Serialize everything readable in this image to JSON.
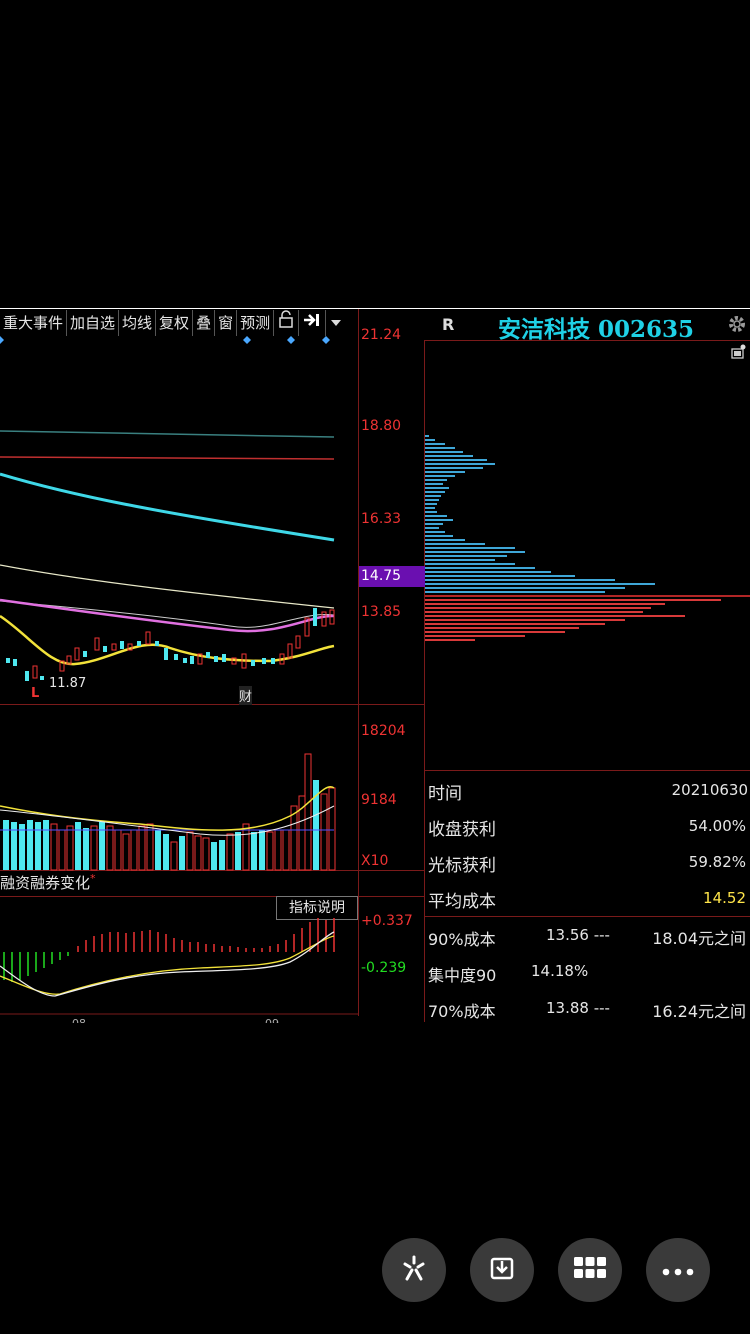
{
  "toolbar": {
    "items": [
      "重大事件",
      "加自选",
      "均线",
      "复权",
      "叠",
      "窗",
      "预测"
    ],
    "lock_icon": "lock-open-icon",
    "exit_icon": "arrow-right-bar-icon",
    "dropdown_icon": "triangle-down-icon"
  },
  "header": {
    "r_label": "R",
    "stock_title": "安洁科技 002635",
    "settings_icon": "gear-icon",
    "small_icon": "lock-small-icon"
  },
  "price_axis": {
    "labels": [
      "21.24",
      "18.80",
      "16.33",
      "14.75",
      "13.85"
    ],
    "current": "14.75",
    "low_marker": "11.87",
    "low_letter": "L",
    "fin_marker": "财"
  },
  "volume_axis": {
    "labels": [
      "18204",
      "9184",
      "X10"
    ]
  },
  "indicator": {
    "tab_label": "融资融券变化",
    "tab_dot": "*",
    "explain_button": "指标说明",
    "axis_labels": [
      "+0.337",
      "-0.239"
    ],
    "bottom_ticks": [
      "08",
      "09"
    ]
  },
  "info_panel": {
    "time_label": "时间",
    "time_value": "20210630",
    "close_profit_label": "收盘获利",
    "close_profit_value": "54.00%",
    "cursor_profit_label": "光标获利",
    "cursor_profit_value": "59.82%",
    "avg_cost_label": "平均成本",
    "avg_cost_value": "14.52",
    "cost90_label": "90%成本",
    "cost90_low": "13.56 ---",
    "cost90_high": "18.04元之间",
    "conc90_label": "集中度90",
    "conc90_value": "14.18%",
    "cost70_label": "70%成本",
    "cost70_low": "13.88 ---",
    "cost70_high": "16.24元之间"
  },
  "colors": {
    "accent_cyan": "#1fd1e6",
    "up_red": "#e33333",
    "down_cyan": "#4fe8f0",
    "ma_yellow": "#f2e23a",
    "ma_pink": "#e070e0",
    "price_box": "#6a0fb0"
  },
  "actions": {
    "icons": [
      "sparkle-icon",
      "download-icon",
      "grid-icon",
      "more-icon"
    ]
  }
}
